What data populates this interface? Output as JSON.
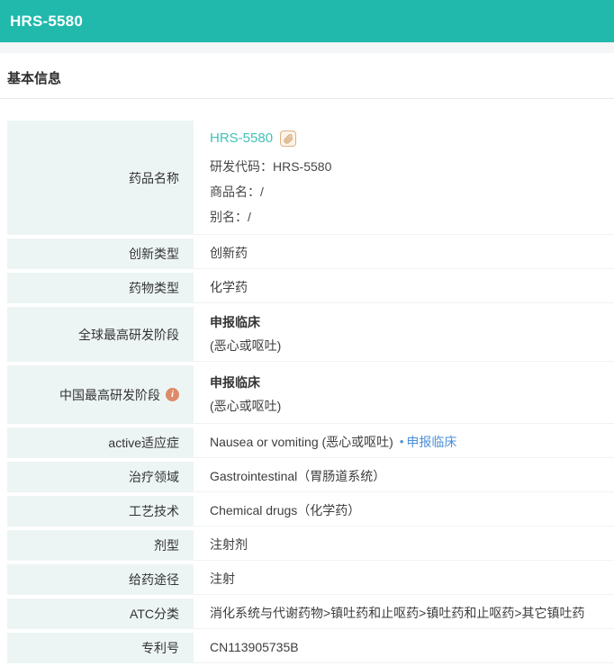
{
  "header": {
    "title": "HRS-5580"
  },
  "section": {
    "title": "基本信息"
  },
  "colors": {
    "accent_teal": "#20b9ac",
    "label_cell_bg": "#edf5f4",
    "substrip_bg": "#f4f6f7",
    "drug_link_teal": "#41c2b7",
    "stage_link_blue": "#4a8fd8",
    "info_icon_orange": "#dd8a68",
    "link_badge_tan": "#ddb183"
  },
  "icons": {
    "paperclip_name": "paperclip-icon",
    "info_name": "info-icon",
    "info_glyph": "i"
  },
  "table": {
    "rows": [
      {
        "label": "药品名称",
        "link": "HRS-5580",
        "lines": [
          "研发代码：HRS-5580",
          "商品名：/",
          "别名：/"
        ]
      },
      {
        "label": "创新类型",
        "value": "创新药"
      },
      {
        "label": "药物类型",
        "value": "化学药"
      },
      {
        "label": "全球最高研发阶段",
        "stage": "申报临床",
        "scope": "(恶心或呕吐)"
      },
      {
        "label": "中国最高研发阶段",
        "stage": "申报临床",
        "scope": "(恶心或呕吐)"
      },
      {
        "label": "active适应症",
        "value": "Nausea or vomiting (恶心或呕吐)",
        "bullet": "•",
        "stage_link": "申报临床"
      },
      {
        "label": "治疗领域",
        "value": "Gastrointestinal（胃肠道系统）"
      },
      {
        "label": "工艺技术",
        "value": "Chemical drugs（化学药）"
      },
      {
        "label": "剂型",
        "value": "注射剂"
      },
      {
        "label": "给药途径",
        "value": "注射"
      },
      {
        "label": "ATC分类",
        "value": "消化系统与代谢药物>镇吐药和止呕药>镇吐药和止呕药>其它镇吐药"
      },
      {
        "label": "专利号",
        "value": "CN113905735B"
      }
    ]
  }
}
